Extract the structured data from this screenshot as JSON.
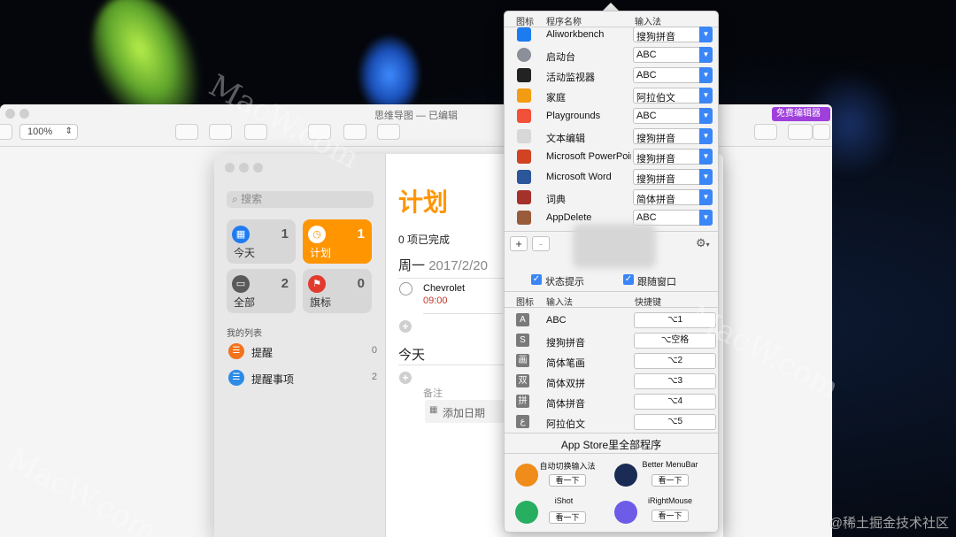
{
  "mindmap_window": {
    "title": "思维导图 — 已编辑",
    "zoom": "100%",
    "free_editor_label": "免费编辑器"
  },
  "reminders": {
    "search_placeholder": "搜索",
    "tiles": [
      {
        "label": "今天",
        "count": "1",
        "color": "#1e7cf2",
        "icon": "calendar-icon"
      },
      {
        "label": "计划",
        "count": "1",
        "color": "#ff9500",
        "icon": "clock-icon",
        "active": true
      },
      {
        "label": "全部",
        "count": "2",
        "color": "#5a5a5a",
        "icon": "tray-icon"
      },
      {
        "label": "旗标",
        "count": "0",
        "color": "#e23b2e",
        "icon": "flag-icon"
      }
    ],
    "my_lists_title": "我的列表",
    "lists": [
      {
        "name": "提醒",
        "count": "0",
        "color": "#f2731c"
      },
      {
        "name": "提醒事项",
        "count": "2",
        "color": "#2b8be6"
      }
    ],
    "main_title": "计划",
    "completed_text": "0 项已完成",
    "section1": {
      "day": "周一",
      "date": "2017/2/20"
    },
    "item": {
      "title": "Chevrolet",
      "time": "09:00"
    },
    "section2": {
      "day": "今天"
    },
    "notes_placeholder": "备注",
    "add_date": "添加日期"
  },
  "input_panel": {
    "headers": {
      "icon": "图标",
      "app_name": "程序名称",
      "input_method": "输入法"
    },
    "apps": [
      {
        "name": "Aliworkbench",
        "im": "搜狗拼音",
        "color": "#1d7bf0"
      },
      {
        "name": "启动台",
        "im": "ABC",
        "color": "#8a8f99"
      },
      {
        "name": "活动监视器",
        "im": "ABC",
        "color": "#222222"
      },
      {
        "name": "家庭",
        "im": "阿拉伯文",
        "color": "#f39c12"
      },
      {
        "name": "Playgrounds",
        "im": "ABC",
        "color": "#f05138"
      },
      {
        "name": "文本编辑",
        "im": "搜狗拼音",
        "color": "#d8d8d8"
      },
      {
        "name": "Microsoft PowerPoint",
        "im": "搜狗拼音",
        "color": "#d04423"
      },
      {
        "name": "Microsoft Word",
        "im": "搜狗拼音",
        "color": "#2b579a"
      },
      {
        "name": "词典",
        "im": "简体拼音",
        "color": "#a5312b"
      },
      {
        "name": "AppDelete",
        "im": "ABC",
        "color": "#9a5b3a"
      }
    ],
    "add_label": "+",
    "remove_label": "-",
    "settings_label": "⚙",
    "checkbox1": "状态提示",
    "checkbox2": "跟随窗口",
    "im_headers": {
      "icon": "图标",
      "input_method": "输入法",
      "hotkey": "快捷键"
    },
    "input_methods": [
      {
        "glyph": "A",
        "name": "ABC",
        "hotkey": "⌥1"
      },
      {
        "glyph": "S",
        "name": "搜狗拼音",
        "hotkey": "⌥空格"
      },
      {
        "glyph": "画",
        "name": "简体笔画",
        "hotkey": "⌥2"
      },
      {
        "glyph": "双",
        "name": "简体双拼",
        "hotkey": "⌥3"
      },
      {
        "glyph": "拼",
        "name": "简体拼音",
        "hotkey": "⌥4"
      },
      {
        "glyph": "ع",
        "name": "阿拉伯文",
        "hotkey": "⌥5"
      }
    ],
    "store_title": "App Store里全部程序",
    "store_apps": [
      {
        "name": "自动切换输入法",
        "button": "看一下",
        "color": "#f08c1a"
      },
      {
        "name": "Better MenuBar",
        "button": "看一下",
        "color": "#1a2b55"
      },
      {
        "name": "iShot",
        "button": "看一下",
        "color": "#27ae60"
      },
      {
        "name": "iRightMouse",
        "button": "看一下",
        "color": "#6c5ce7"
      }
    ]
  },
  "watermarks": {
    "macw": "MacW.com",
    "corner": "@稀土掘金技术社区"
  }
}
